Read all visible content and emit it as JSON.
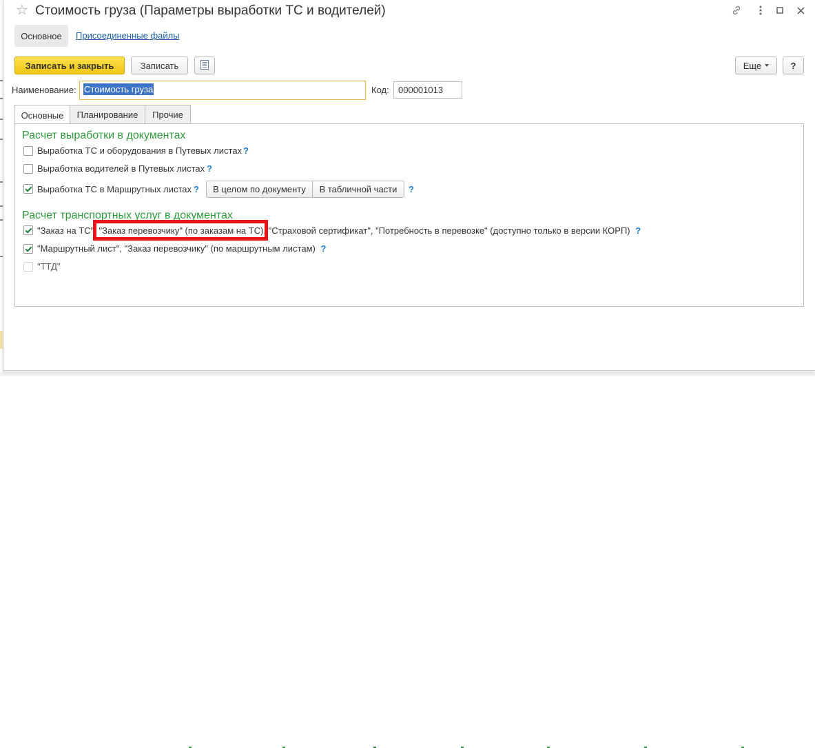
{
  "window": {
    "title": "Стоимость груза (Параметры выработки ТС и водителей)"
  },
  "nav": {
    "main_label": "Основное",
    "files_label": "Присоединенные файлы"
  },
  "toolbar": {
    "save_close_label": "Записать и закрыть",
    "save_label": "Записать",
    "more_label": "Еще",
    "help_label": "?"
  },
  "form": {
    "name_label": "Наименование:",
    "name_value": "Стоимость груза",
    "code_label": "Код:",
    "code_value": "000001013"
  },
  "tabs": [
    {
      "label": "Основные",
      "active": true
    },
    {
      "label": "Планирование",
      "active": false
    },
    {
      "label": "Прочие",
      "active": false
    }
  ],
  "section1": {
    "title": "Расчет выработки в документах",
    "items": [
      {
        "label": "Выработка ТС и оборудования в Путевых листах",
        "checked": false,
        "help": "?"
      },
      {
        "label": "Выработка водителей в Путевых листах",
        "checked": false,
        "help": "?"
      },
      {
        "label": "Выработка ТС в Маршрутных листах",
        "checked": true,
        "help": "?"
      }
    ],
    "mode_buttons": [
      "В целом по документу",
      "В табличной части"
    ],
    "mode_help": "?"
  },
  "section2": {
    "title": "Расчет транспортных услуг в документах",
    "items": [
      {
        "label_part1": "\"Заказ на ТС\", ",
        "label_part2": "\"Заказ перевозчику\" (по заказам на ТС)",
        "label_part3": ", \"Страховой сертификат\", \"Потребность в перевозке\" (доступно только в версии КОРП)",
        "checked": true,
        "help": "?"
      },
      {
        "label": "\"Маршрутный лист\", \"Заказ перевозчику\" (по маршрутным листам)",
        "checked": true,
        "help": "?"
      },
      {
        "label": "\"ТТД\"",
        "checked": false,
        "disabled": true
      }
    ]
  },
  "colors": {
    "accent_yellow": "#f1c615",
    "section_green": "#2e9a3c",
    "link_blue": "#1c5ea8",
    "highlight_red": "#e8141a"
  }
}
